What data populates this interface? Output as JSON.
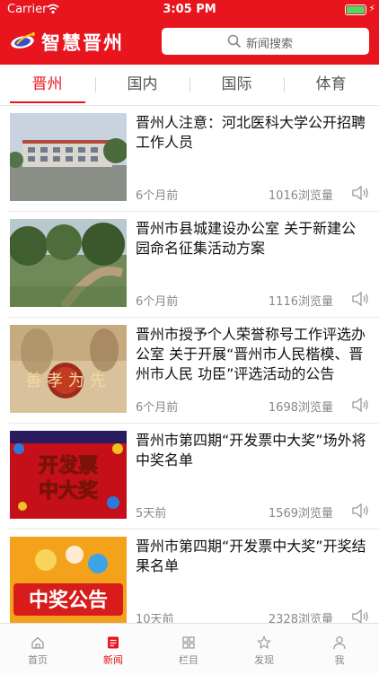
{
  "status_bar": {
    "carrier": "Carrier",
    "time": "3:05 PM"
  },
  "header": {
    "app_title": "智慧晋州",
    "search_placeholder": "新闻搜索"
  },
  "tabs": [
    {
      "label": "晋州"
    },
    {
      "label": "国内"
    },
    {
      "label": "国际"
    },
    {
      "label": "体育"
    }
  ],
  "news": [
    {
      "title": "晋州人注意：河北医科大学公开招聘工作人员",
      "time": "6个月前",
      "views": "1016浏览量"
    },
    {
      "title": "晋州市县城建设办公室 关于新建公园命名征集活动方案",
      "time": "6个月前",
      "views": "1116浏览量"
    },
    {
      "title": "晋州市授予个人荣誉称号工作评选办公室 关于开展“晋州市人民楷模、晋州市人民 功臣”评选活动的公告",
      "time": "6个月前",
      "views": "1698浏览量"
    },
    {
      "title": "晋州市第四期“开发票中大奖”场外将中奖名单",
      "time": "5天前",
      "views": "1569浏览量"
    },
    {
      "title": "晋州市第四期“开发票中大奖”开奖结果名单",
      "time": "10天前",
      "views": "2328浏览量"
    }
  ],
  "thumb_text": {
    "t3": "善 孝 为 先",
    "t4_line1": "开发票",
    "t4_line2": "中大奖",
    "t5": "中奖公告"
  },
  "bottom_nav": [
    {
      "label": "首页"
    },
    {
      "label": "新闻"
    },
    {
      "label": "栏目"
    },
    {
      "label": "发现"
    },
    {
      "label": "我"
    }
  ],
  "colors": {
    "brand": "#e8141e",
    "text": "#111111",
    "muted": "#888888"
  }
}
